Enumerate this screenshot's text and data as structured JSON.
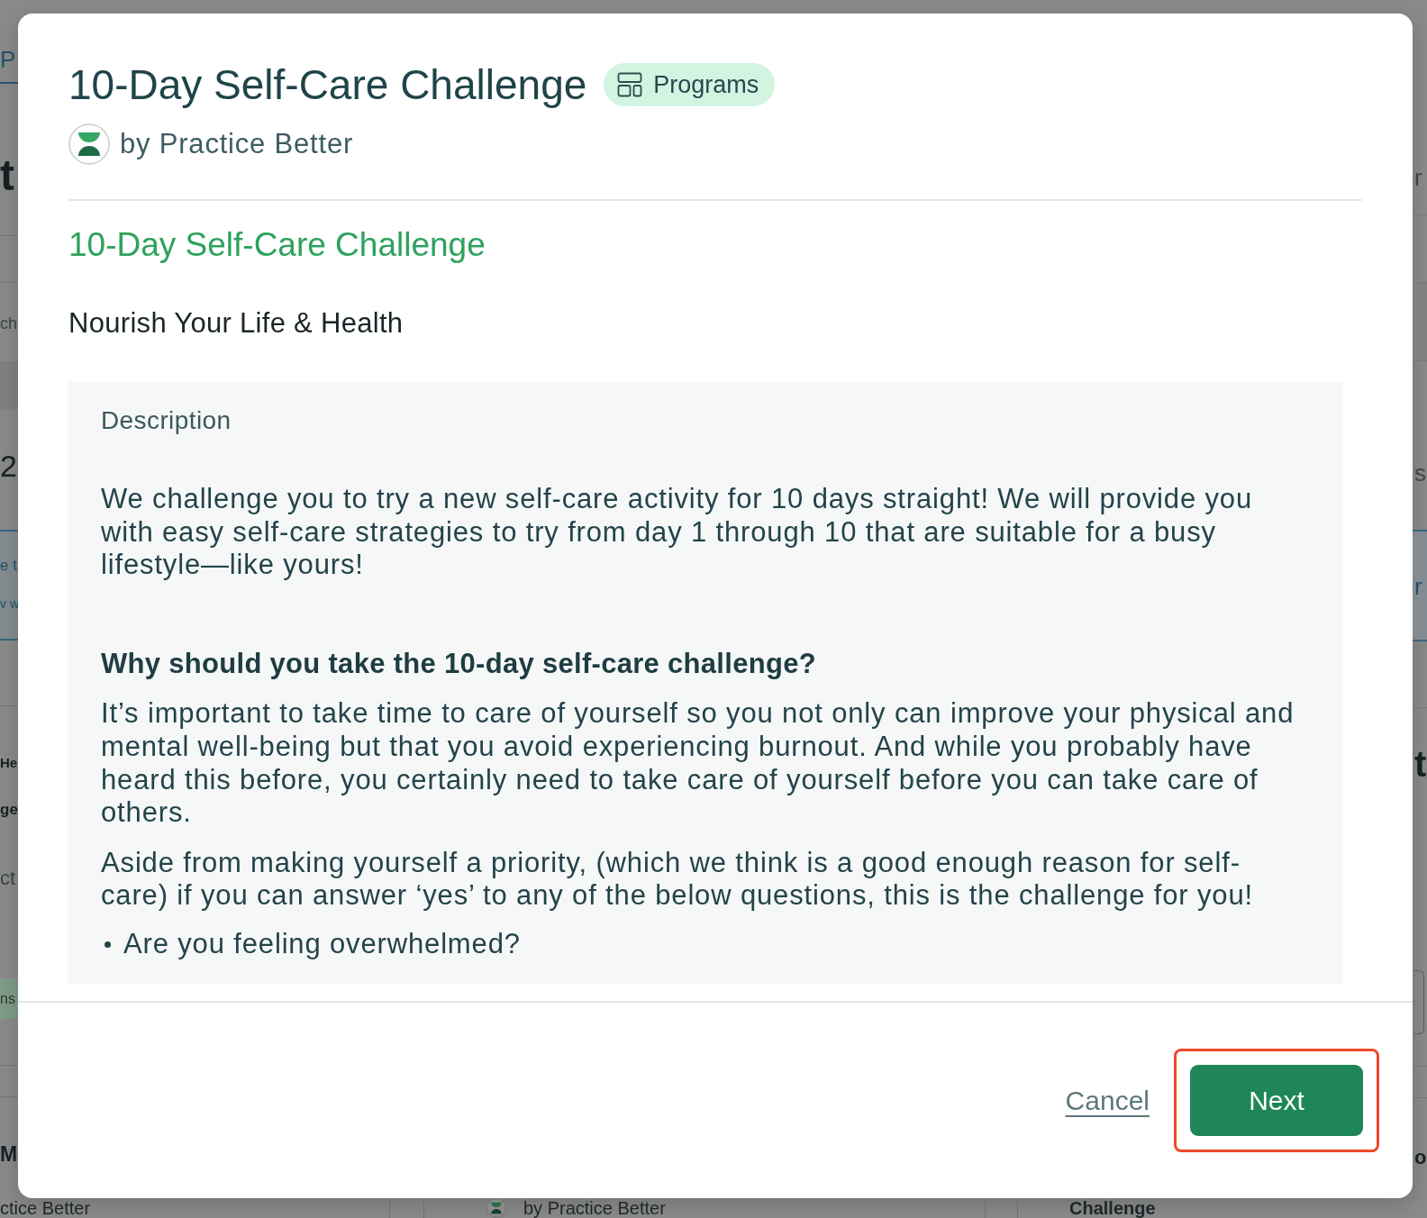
{
  "backdrop": {
    "left_edge": [
      {
        "kind": "link",
        "text": "P"
      },
      {
        "kind": "heading",
        "text": "t"
      },
      {
        "kind": "text",
        "text": "ch"
      },
      {
        "kind": "number",
        "text": "2"
      },
      {
        "kind": "link",
        "text": "e t"
      },
      {
        "kind": "link",
        "text": "v w"
      },
      {
        "kind": "heading",
        "text": "He"
      },
      {
        "kind": "heading",
        "text": "ge"
      },
      {
        "kind": "text",
        "text": "ct"
      },
      {
        "kind": "tag",
        "text": "ns"
      },
      {
        "kind": "heading",
        "text": "M"
      }
    ],
    "right_edge": [
      {
        "kind": "text",
        "text": "r"
      },
      {
        "kind": "text",
        "text": "s"
      },
      {
        "kind": "link",
        "text": "r"
      },
      {
        "kind": "heading",
        "text": "t"
      },
      {
        "kind": "field"
      },
      {
        "kind": "heading",
        "text": "o"
      }
    ],
    "bottom_edge": [
      {
        "kind": "text",
        "text": "ctice Better"
      },
      {
        "kind": "author",
        "text": "by Practice Better"
      },
      {
        "kind": "heading",
        "text": "Challenge"
      }
    ]
  },
  "modal": {
    "title": "10-Day Self-Care Challenge",
    "badge": {
      "label": "Programs"
    },
    "author": "by Practice Better",
    "heading": "10-Day Self-Care Challenge",
    "subtitle": "Nourish Your Life & Health",
    "description": {
      "label": "Description",
      "blocks": [
        {
          "kind": "paragraph",
          "text": "We challenge you to try a new self-care activity for 10 days straight! We will provide you with easy self-care strategies to try from day 1 through 10 that are suitable for a busy lifestyle—like yours!"
        },
        {
          "kind": "heading",
          "text": "Why should you take the 10-day self-care challenge?"
        },
        {
          "kind": "paragraph",
          "text": "It’s important to take time to care of yourself so you not only can improve your physical and mental well-being but that you avoid experiencing burnout. And while you probably have heard this before, you certainly need to take care of yourself before you can take care of others."
        },
        {
          "kind": "paragraph",
          "text": "Aside from making yourself a priority, (which we think is a good enough reason for self-care) if you can answer ‘yes’ to any of the below questions, this is the challenge for you!"
        },
        {
          "kind": "bullet",
          "text": "Are you feeling overwhelmed?"
        }
      ]
    },
    "buttons": [
      {
        "kind": "link",
        "label": "Cancel",
        "highlighted": false
      },
      {
        "kind": "primary",
        "label": "Next",
        "highlighted": true
      }
    ]
  }
}
